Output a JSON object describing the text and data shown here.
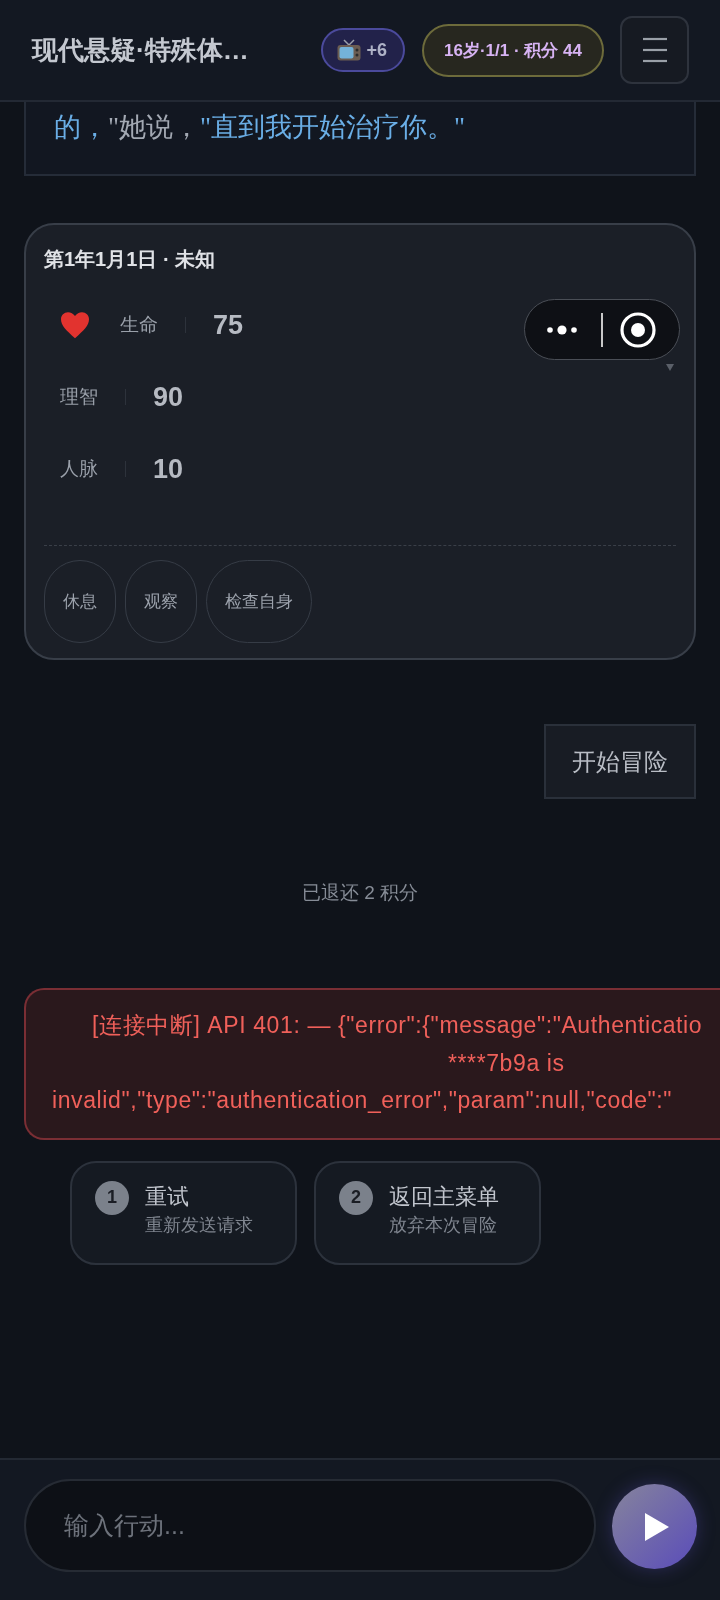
{
  "header": {
    "title": "现代悬疑·特殊体…",
    "reward_badge": "+6",
    "status_badge": "16岁·1/1 · 积分 44"
  },
  "story": {
    "segments": [
      {
        "kind": "speech",
        "text": "的，"
      },
      {
        "kind": "narration",
        "text": "\"她说，"
      },
      {
        "kind": "speech",
        "text": "\"直到我开始治疗你。\""
      }
    ]
  },
  "status_card": {
    "title": "第1年1月1日 · 未知",
    "stats": [
      {
        "kind": "featured",
        "label": "生命",
        "value": "75"
      },
      {
        "kind": "plain",
        "label": "理智",
        "value": "90"
      },
      {
        "kind": "plain",
        "label": "人脉",
        "value": "10"
      }
    ],
    "actions": [
      "休息",
      "观察",
      "检查自身"
    ]
  },
  "user_message": "开始冒险",
  "system_note": "已退还 2 积分",
  "error": {
    "lines": [
      "[连接中断] API 401: — {\"error\":{\"message\":\"Authenticatio",
      "****7b9a is",
      "invalid\",\"type\":\"authentication_error\",\"param\":null,\"code\":\""
    ]
  },
  "options": [
    {
      "number": "1",
      "title": "重试",
      "subtitle": "重新发送请求"
    },
    {
      "number": "2",
      "title": "返回主菜单",
      "subtitle": "放弃本次冒险"
    }
  ],
  "input": {
    "placeholder": "输入行动..."
  }
}
